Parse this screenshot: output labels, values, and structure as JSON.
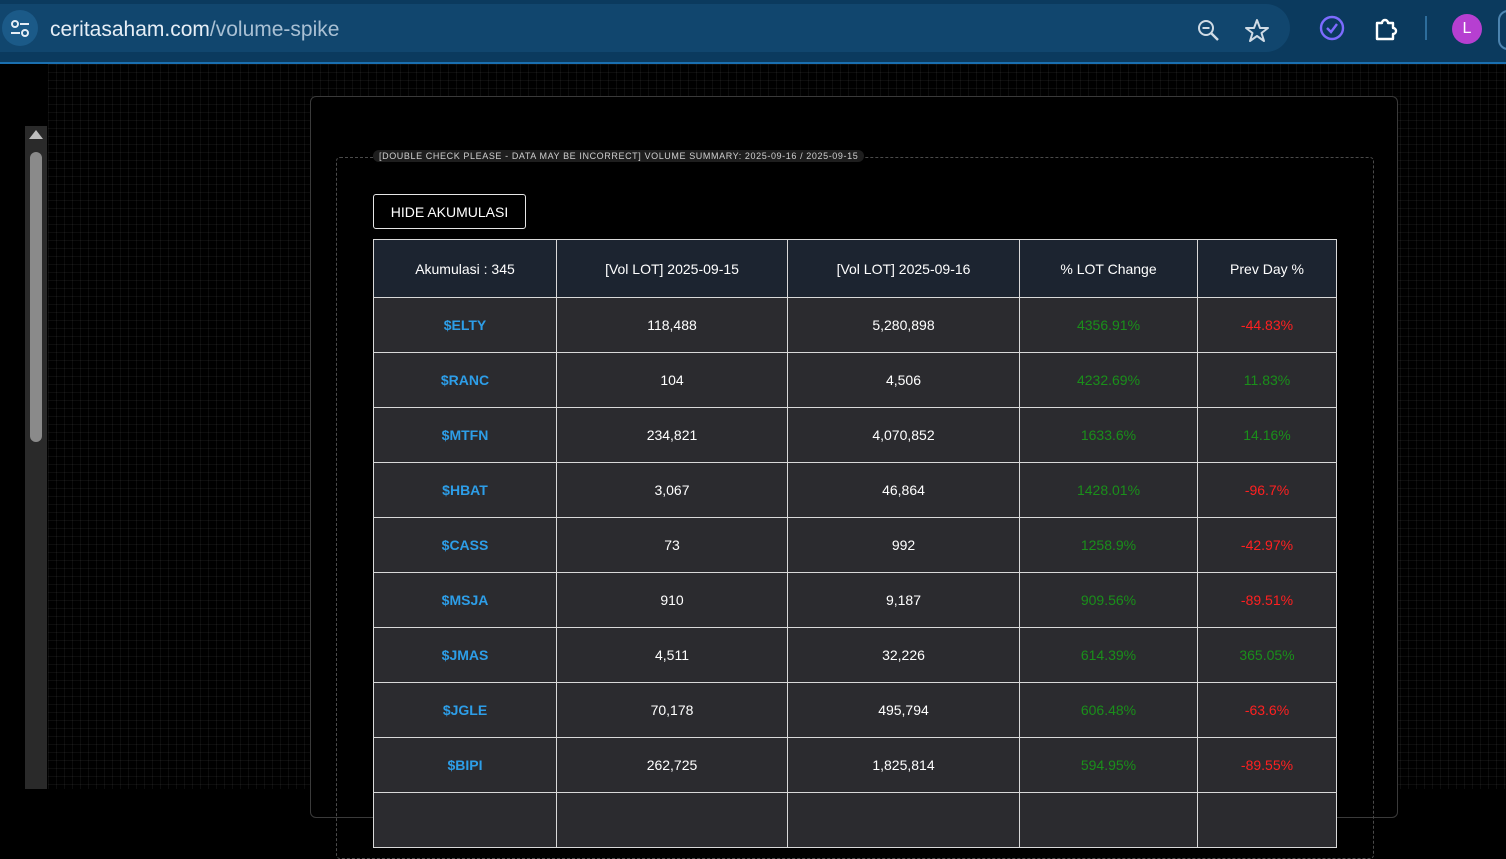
{
  "browser": {
    "url_host": "ceritasaham.com",
    "url_path": "/volume-spike",
    "avatar_letter": "L"
  },
  "panel": {
    "legend": "[DOUBLE CHECK PLEASE - DATA MAY BE INCORRECT] VOLUME SUMMARY: 2025-09-16 / 2025-09-15",
    "hide_button": "HIDE AKUMULASI"
  },
  "table": {
    "headers": [
      "Akumulasi : 345",
      "[Vol LOT] 2025-09-15",
      "[Vol LOT] 2025-09-16",
      "% LOT Change",
      "Prev Day %"
    ],
    "rows": [
      {
        "ticker": "$ELTY",
        "vol_prev": "118,488",
        "vol_curr": "5,280,898",
        "change": "4356.91%",
        "prev_day": "-44.83%"
      },
      {
        "ticker": "$RANC",
        "vol_prev": "104",
        "vol_curr": "4,506",
        "change": "4232.69%",
        "prev_day": "11.83%"
      },
      {
        "ticker": "$MTFN",
        "vol_prev": "234,821",
        "vol_curr": "4,070,852",
        "change": "1633.6%",
        "prev_day": "14.16%"
      },
      {
        "ticker": "$HBAT",
        "vol_prev": "3,067",
        "vol_curr": "46,864",
        "change": "1428.01%",
        "prev_day": "-96.7%"
      },
      {
        "ticker": "$CASS",
        "vol_prev": "73",
        "vol_curr": "992",
        "change": "1258.9%",
        "prev_day": "-42.97%"
      },
      {
        "ticker": "$MSJA",
        "vol_prev": "910",
        "vol_curr": "9,187",
        "change": "909.56%",
        "prev_day": "-89.51%"
      },
      {
        "ticker": "$JMAS",
        "vol_prev": "4,511",
        "vol_curr": "32,226",
        "change": "614.39%",
        "prev_day": "365.05%"
      },
      {
        "ticker": "$JGLE",
        "vol_prev": "70,178",
        "vol_curr": "495,794",
        "change": "606.48%",
        "prev_day": "-63.6%"
      },
      {
        "ticker": "$BIPI",
        "vol_prev": "262,725",
        "vol_curr": "1,825,814",
        "change": "594.95%",
        "prev_day": "-89.55%"
      },
      {
        "ticker": "",
        "vol_prev": "",
        "vol_curr": "",
        "change": "",
        "prev_day": ""
      }
    ]
  },
  "colors": {
    "positive": "#1a8f1a",
    "negative": "#ff2020",
    "ticker": "#2d9ee8"
  }
}
